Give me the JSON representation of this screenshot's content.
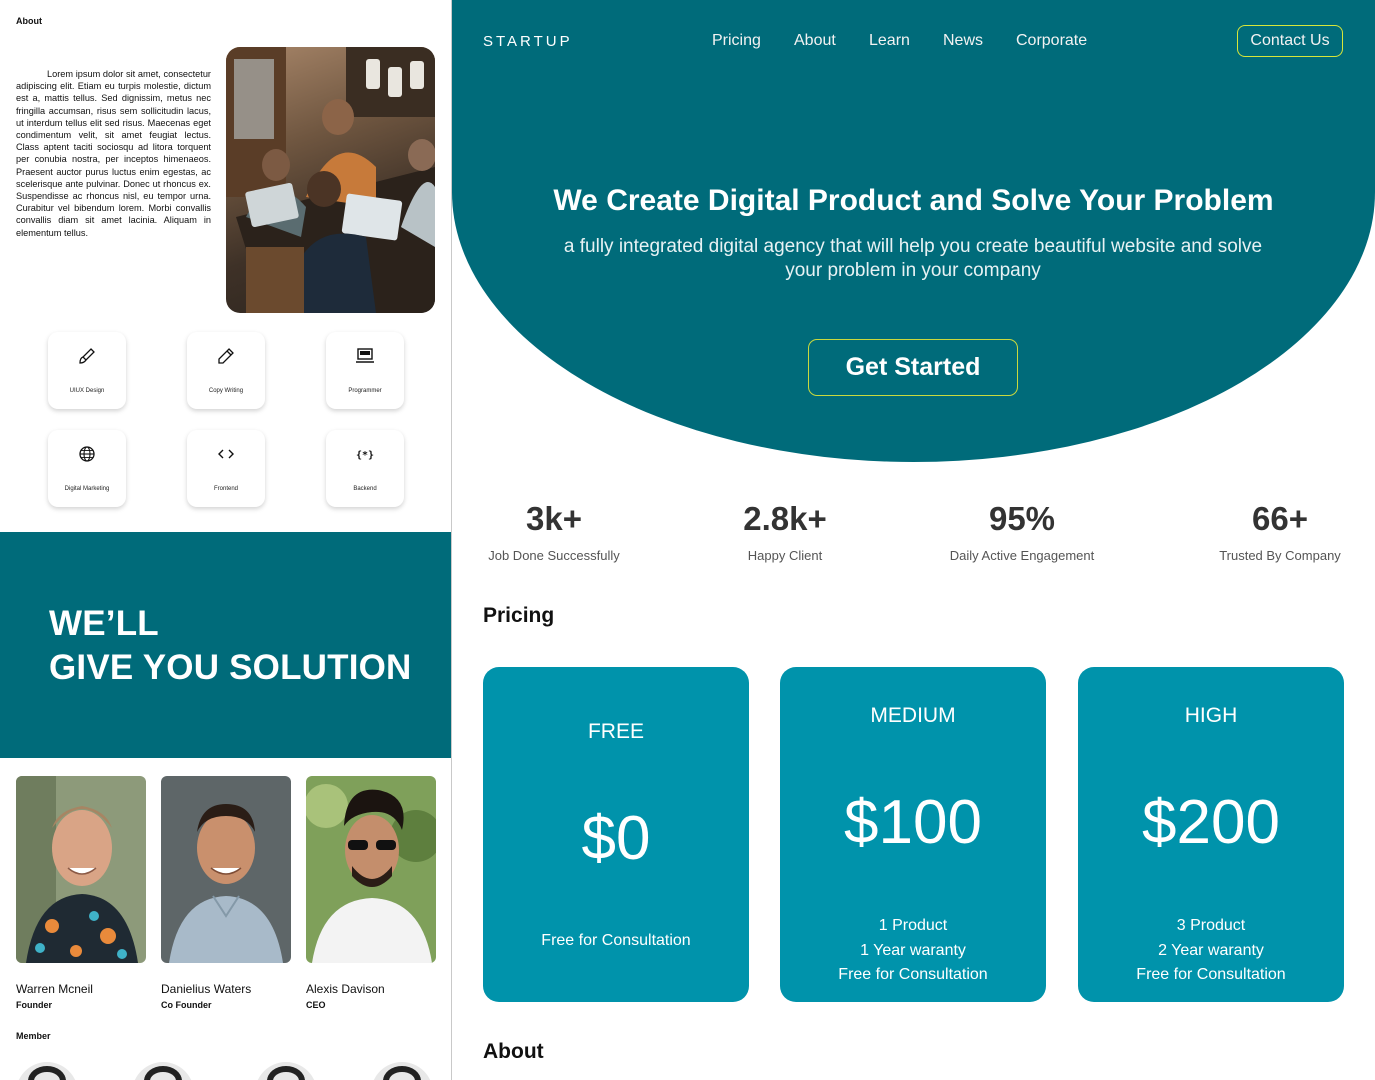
{
  "left": {
    "about_heading": "About",
    "about_text": "Lorem ipsum dolor sit amet, consectetur adipiscing elit. Etiam eu turpis molestie, dictum est a, mattis tellus. Sed dignissim, metus nec fringilla accumsan, risus sem sollicitudin lacus, ut interdum tellus elit sed risus. Maecenas eget condimentum velit, sit amet feugiat lectus. Class aptent taciti sociosqu ad litora torquent per conubia nostra, per inceptos himenaeos. Praesent auctor purus luctus enim egestas, ac scelerisque ante pulvinar. Donec ut rhoncus ex. Suspendisse ac rhoncus nisl, eu tempor urna. Curabitur vel bibendum lorem. Morbi convallis convallis diam sit amet lacinia. Aliquam in elementum tellus.",
    "services": [
      {
        "label": "UIUX Design",
        "icon": "brush-icon"
      },
      {
        "label": "Copy Writing",
        "icon": "pencil-icon"
      },
      {
        "label": "Programmer",
        "icon": "laptop-icon"
      },
      {
        "label": "Digital Marketing",
        "icon": "globe-icon"
      },
      {
        "label": "Frontend",
        "icon": "code-icon"
      },
      {
        "label": "Backend",
        "icon": "braces-icon"
      }
    ],
    "solution_line1": "WE’LL",
    "solution_line2": "GIVE YOU SOLUTION",
    "people": [
      {
        "name": "Warren Mcneil",
        "role": "Founder"
      },
      {
        "name": "Danielius Waters",
        "role": "Co Founder"
      },
      {
        "name": "Alexis Davison",
        "role": "CEO"
      }
    ],
    "member_heading": "Member"
  },
  "right": {
    "brand": "STARTUP",
    "nav": [
      "Pricing",
      "About",
      "Learn",
      "News",
      "Corporate"
    ],
    "contact_label": "Contact Us",
    "hero_title": "We Create Digital Product and Solve Your Problem",
    "hero_sub": "a fully integrated digital agency that will help you create beautiful website and solve your problem in your company",
    "cta_label": "Get Started",
    "stats": [
      {
        "value": "3k+",
        "label": "Job Done Successfully"
      },
      {
        "value": "2.8k+",
        "label": "Happy Client"
      },
      {
        "value": "95%",
        "label": "Daily Active Engagement"
      },
      {
        "value": "66+",
        "label": "Trusted By Company"
      }
    ],
    "pricing_heading": "Pricing",
    "plans": [
      {
        "tier": "FREE",
        "price": "$0",
        "features": [
          "Free for Consultation"
        ]
      },
      {
        "tier": "MEDIUM",
        "price": "$100",
        "features": [
          "1 Product",
          "1 Year waranty",
          "Free for Consultation"
        ]
      },
      {
        "tier": "HIGH",
        "price": "$200",
        "features": [
          "3 Product",
          "2 Year waranty",
          "Free for Consultation"
        ]
      }
    ],
    "about_heading": "About"
  },
  "colors": {
    "primary_teal": "#006b7a",
    "card_teal": "#0093ab",
    "accent_outline": "#d7e63a"
  }
}
